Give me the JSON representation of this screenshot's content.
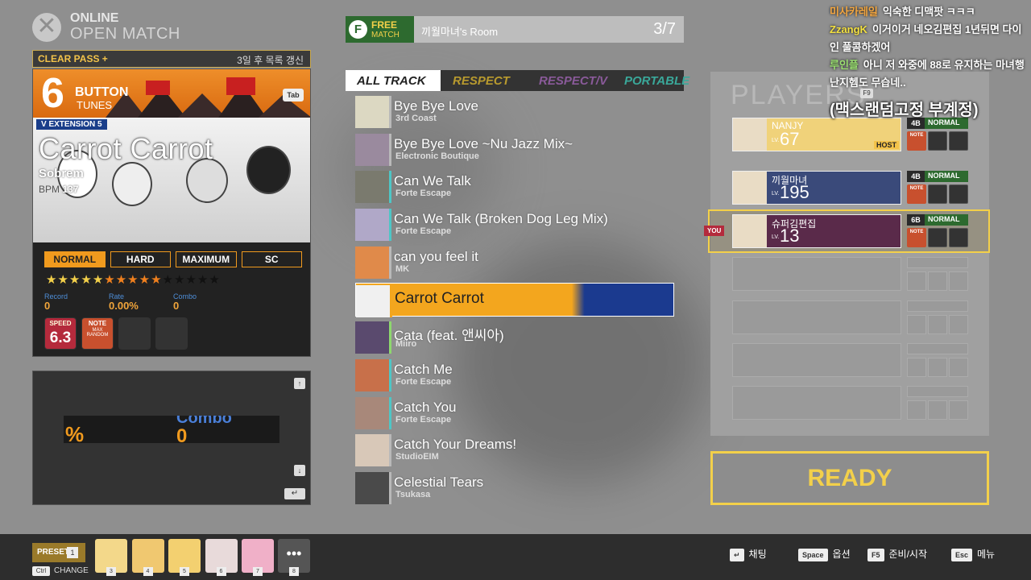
{
  "header": {
    "mode_line1": "ONLINE",
    "mode_line2": "OPEN MATCH"
  },
  "left_panel": {
    "clear_pass": "CLEAR PASS +",
    "refresh_notice": "3일 후 목록 갱신",
    "button_count": "6",
    "button_word": "BUTTON",
    "tunes_word": "TUNES",
    "tab_key": "Tab",
    "pack": "V EXTENSION 5",
    "song_title": "Carrot Carrot",
    "artist": "Sobrem",
    "bpm_label": "BPM",
    "bpm_value": "137",
    "difficulties": [
      "NORMAL",
      "HARD",
      "MAXIMUM",
      "SC"
    ],
    "active_difficulty": "NORMAL",
    "stars": {
      "yellow": 5,
      "orange": 5,
      "dark": 5
    },
    "record_label": "Record",
    "record_value": "0",
    "rate_label": "Rate",
    "rate_value": "0.00%",
    "combo_label": "Combo",
    "combo_value": "0",
    "speed_label": "SPEED",
    "speed_value": "6.3",
    "note_label": "NOTE",
    "note_sub": "MAX RANDOM"
  },
  "preview": {
    "pct": "%",
    "combo_label": "Combo",
    "combo_value": "0",
    "up_key": "↑",
    "down_key": "↓",
    "enter_key": "↵"
  },
  "room": {
    "badge_f": "F",
    "badge_free": "FREE",
    "badge_match": "MATCH",
    "name": "끼월마녀's Room",
    "count": "3/7"
  },
  "tabs": [
    {
      "label": "ALL TRACK",
      "color": "#222222"
    },
    {
      "label": "RESPECT",
      "color": "#b89a2e"
    },
    {
      "label": "RESPECT/V",
      "color": "#8a5a9a"
    },
    {
      "label": "PORTABLE",
      "color": "#3aa89a"
    }
  ],
  "songs": [
    {
      "title": "Bye Bye Love",
      "artist": "3rd Coast",
      "stripe": "#b9b9b9",
      "thumb": "#dcd8c2"
    },
    {
      "title": "Bye Bye Love ~Nu Jazz Mix~",
      "artist": "Electronic Boutique",
      "stripe": "#b9b9b9",
      "thumb": "#9a8a9e"
    },
    {
      "title": "Can We Talk",
      "artist": "Forte Escape",
      "stripe": "#4ec6c6",
      "thumb": "#7a7a6e"
    },
    {
      "title": "Can We Talk (Broken Dog Leg Mix)",
      "artist": "Forte Escape",
      "stripe": "#4ec6c6",
      "thumb": "#b0a8c8"
    },
    {
      "title": "can you feel it",
      "artist": "MK",
      "stripe": "#b9b9b9",
      "thumb": "#e08a4a"
    },
    {
      "title": "Carrot Carrot",
      "artist": "",
      "stripe": "#f3a61e",
      "thumb": "#f0f0f0"
    },
    {
      "title": "Cata (feat. 앤씨아)",
      "artist": "Miiro",
      "stripe": "#8ed86e",
      "thumb": "#5a4a6e"
    },
    {
      "title": "Catch Me",
      "artist": "Forte Escape",
      "stripe": "#4ec6c6",
      "thumb": "#c8704a"
    },
    {
      "title": "Catch You",
      "artist": "Forte Escape",
      "stripe": "#4ec6c6",
      "thumb": "#a8887a"
    },
    {
      "title": "Catch Your Dreams!",
      "artist": "StudioEIM",
      "stripe": "#b9b9b9",
      "thumb": "#d8c8b8"
    },
    {
      "title": "Celestial Tears",
      "artist": "Tsukasa",
      "stripe": "#b9b9b9",
      "thumb": "#4a4a4a"
    }
  ],
  "players": {
    "title": "PLAYERS",
    "list": [
      {
        "name": "NANJY",
        "lv_label": "LV.",
        "level": "67",
        "host": "HOST",
        "mode": "4B",
        "difficulty": "NORMAL",
        "bg": "#f0d27a"
      },
      {
        "name": "끼월마녀",
        "lv_label": "LV.",
        "level": "195",
        "host": "",
        "mode": "4B",
        "difficulty": "NORMAL",
        "bg": "#3a4a7a"
      },
      {
        "name": "슈퍼김편집",
        "lv_label": "LV.",
        "level": "13",
        "host": "",
        "mode": "6B",
        "difficulty": "NORMAL",
        "bg": "#5a2a4a"
      }
    ],
    "you_badge": "YOU",
    "note_label": "NOTE"
  },
  "ready_label": "READY",
  "chat": [
    {
      "user": "미사카레일",
      "user_color": "#f3a640",
      "msg": "익숙한 디맥팟 ㅋㅋㅋ"
    },
    {
      "user": "ZzangK",
      "user_color": "#f3e040",
      "msg": "이거이거 네오김편집 1년뒤면 다이인 풀콤하겠어"
    },
    {
      "user": "루인플",
      "user_color": "#9ae070",
      "msg": "아니 저 와중에 88로 유지하는 마녀행 난지헴도 무습네.."
    }
  ],
  "overlay_key": "F9",
  "overlay_text": "(맥스랜덤고정 부계정)",
  "bottom": {
    "preset_label": "PRESET",
    "preset_num": "1",
    "ctrl_key": "Ctrl",
    "change_label": "CHANGE",
    "slots": [
      {
        "num": "3",
        "color": "#f3d88a"
      },
      {
        "num": "4",
        "color": "#f0c870"
      },
      {
        "num": "5",
        "color": "#f3d070"
      },
      {
        "num": "6",
        "color": "#e8dada"
      },
      {
        "num": "7",
        "color": "#f0b0c8"
      }
    ],
    "more_label": "•••",
    "more_num": "8",
    "hints": [
      {
        "key": "↵",
        "label": "채팅"
      },
      {
        "key": "Space",
        "label": "옵션"
      },
      {
        "key": "F5",
        "label": "준비/시작"
      },
      {
        "key": "Esc",
        "label": "메뉴"
      }
    ]
  }
}
